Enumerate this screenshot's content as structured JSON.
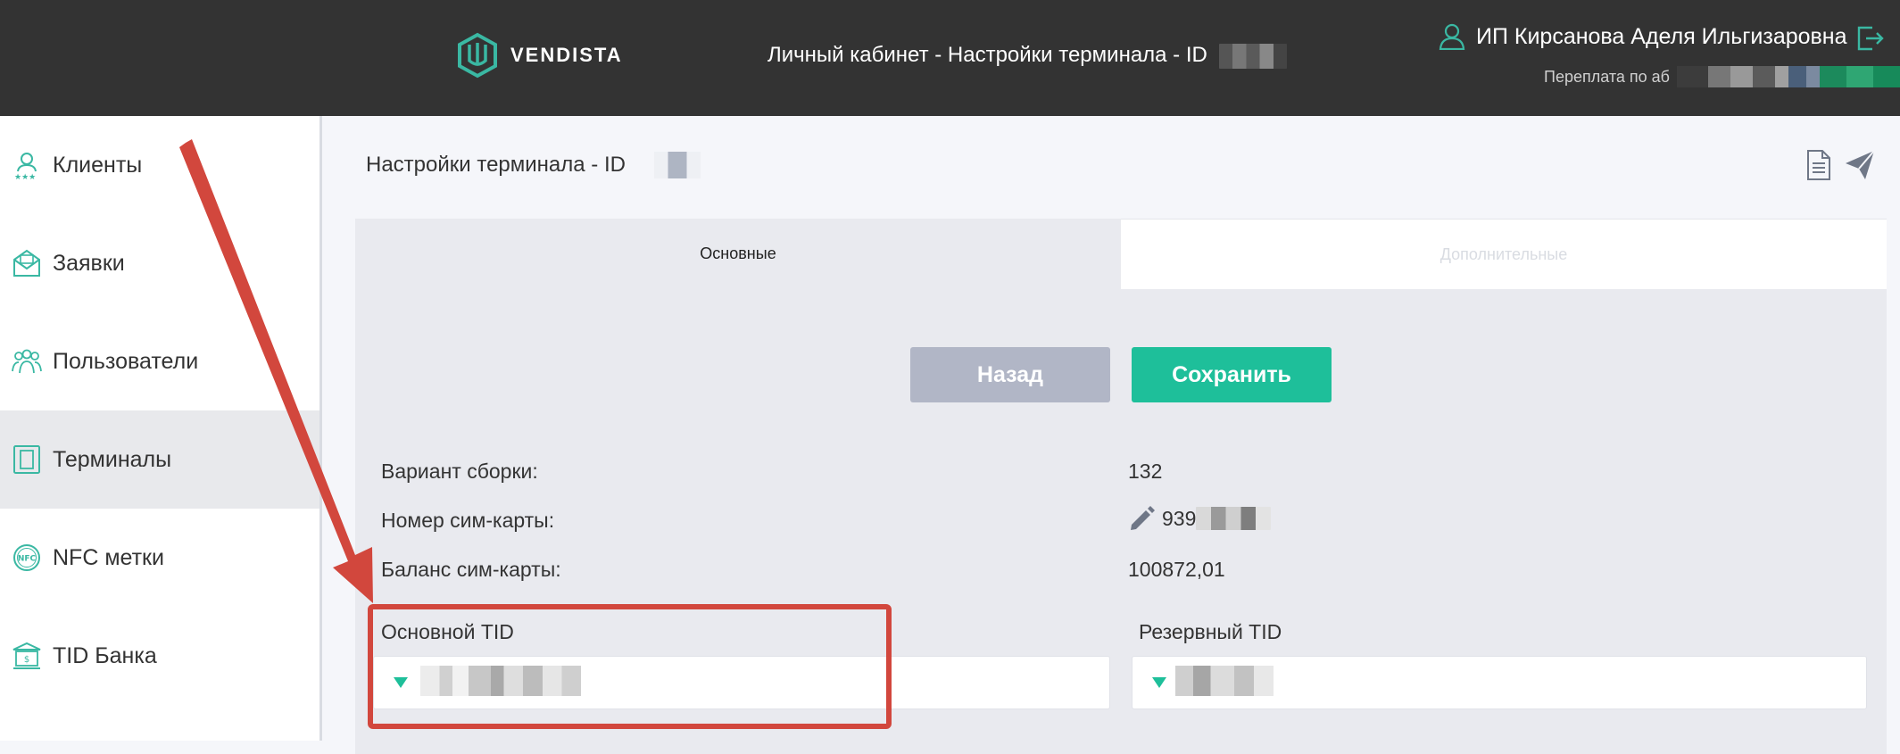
{
  "header": {
    "logo_text": "VENDISTA",
    "title": "Личный кабинет - Настройки терминала - ID",
    "user_name": "ИП Кирсанова Аделя Ильгизаровна",
    "balance_label": "Переплата по аб"
  },
  "sidebar": {
    "items": [
      {
        "label": "Клиенты",
        "icon": "clients-icon"
      },
      {
        "label": "Заявки",
        "icon": "requests-icon"
      },
      {
        "label": "Пользователи",
        "icon": "users-icon"
      },
      {
        "label": "Терминалы",
        "icon": "terminal-icon",
        "active": true
      },
      {
        "label": "NFC метки",
        "icon": "nfc-icon",
        "icon_text": "NFC"
      },
      {
        "label": "TID Банка",
        "icon": "bank-icon"
      }
    ]
  },
  "main": {
    "page_title": "Настройки терминала - ID",
    "tabs": [
      {
        "label": "Основные",
        "active": true
      },
      {
        "label": "Дополнительные",
        "active": false
      }
    ],
    "buttons": {
      "back": "Назад",
      "save": "Сохранить"
    },
    "fields": {
      "build_variant_label": "Вариант сборки:",
      "build_variant_value": "132",
      "sim_number_label": "Номер сим-карты:",
      "sim_number_value": "939",
      "sim_balance_label": "Баланс сим-карты:",
      "sim_balance_value": "100872,01",
      "primary_tid_label": "Основной TID",
      "reserve_tid_label": "Резервный TID"
    }
  },
  "colors": {
    "header_bg": "#333333",
    "accent": "#1ebf9a",
    "back_button": "#b1b6c6",
    "highlight": "#d2473d"
  }
}
